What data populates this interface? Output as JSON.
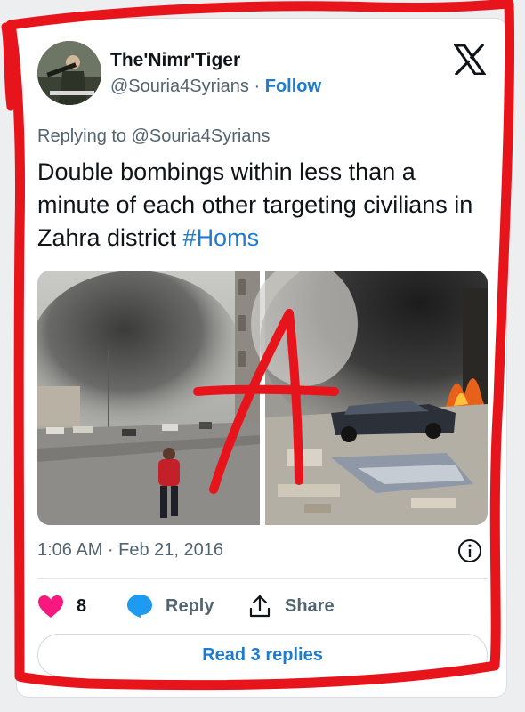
{
  "tweet": {
    "author": {
      "display_name": "The'Nimr'Tiger",
      "handle": "@Souria4Syrians",
      "separator": "·",
      "follow_label": "Follow"
    },
    "replying_to": "Replying to @Souria4Syrians",
    "text": "Double bombings within less than a minute of each other targeting civilians in Zahra district ",
    "hashtag": "#Homs",
    "timestamp": "1:06 AM · Feb 21, 2016",
    "likes": "8",
    "reply_label": "Reply",
    "share_label": "Share",
    "read_replies_label": "Read 3 replies"
  },
  "colors": {
    "accent": "#1d7bd0",
    "like": "#f91880",
    "marker": "#e8141c",
    "muted": "#536471"
  },
  "icons": [
    "x-logo-icon",
    "info-icon",
    "heart-icon",
    "reply-bubble-icon",
    "share-icon"
  ],
  "annotation": {
    "letter": "A"
  }
}
